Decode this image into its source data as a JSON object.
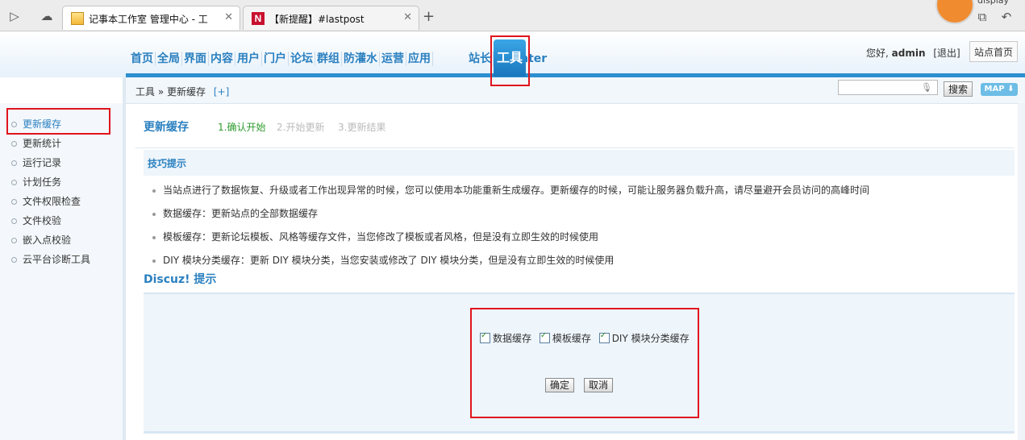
{
  "browser": {
    "tabs": [
      {
        "title": "记事本工作室 管理中心 - 工",
        "active": true,
        "icon": "sticky-note-icon"
      },
      {
        "title": "【新提醒】#lastpost",
        "active": false,
        "icon": "n-logo-icon"
      }
    ],
    "new_tab_label": "+",
    "corner_text": "display"
  },
  "nav": {
    "items": [
      "首页",
      "全局",
      "界面",
      "内容",
      "用户",
      "门户",
      "论坛",
      "群组",
      "防灌水",
      "运营",
      "应用"
    ],
    "active": "工具",
    "after": [
      "站长",
      "UCenter"
    ]
  },
  "user": {
    "greeting": "您好,",
    "name": "admin",
    "logout": "[退出]",
    "home_button": "站点首页"
  },
  "breadcrumb": {
    "section": "工具",
    "separator": "»",
    "page": "更新缓存",
    "add": "[+]"
  },
  "search": {
    "placeholder": "",
    "button": "搜索",
    "map": "MAP"
  },
  "sidebar": {
    "items": [
      {
        "label": "更新缓存",
        "active": true
      },
      {
        "label": "更新统计",
        "active": false
      },
      {
        "label": "运行记录",
        "active": false
      },
      {
        "label": "计划任务",
        "active": false
      },
      {
        "label": "文件权限检查",
        "active": false
      },
      {
        "label": "文件校验",
        "active": false
      },
      {
        "label": "嵌入点校验",
        "active": false
      },
      {
        "label": "云平台诊断工具",
        "active": false
      }
    ]
  },
  "main": {
    "title": "更新缓存",
    "steps": [
      "1.确认开始",
      "2.开始更新",
      "3.更新结果"
    ],
    "tips_label": "技巧提示",
    "tips": [
      "当站点进行了数据恢复、升级或者工作出现异常的时候，您可以使用本功能重新生成缓存。更新缓存的时候，可能让服务器负载升高，请尽量避开会员访问的高峰时间",
      "数据缓存：更新站点的全部数据缓存",
      "模板缓存：更新论坛模板、风格等缓存文件，当您修改了模板或者风格，但是没有立即生效的时候使用",
      "DIY 模块分类缓存：更新 DIY 模块分类，当您安装或修改了 DIY 模块分类，但是没有立即生效的时候使用"
    ],
    "notice_title": "Discuz! 提示",
    "checkboxes": [
      "数据缓存",
      "模板缓存",
      "DIY 模块分类缓存"
    ],
    "confirm": "确定",
    "cancel": "取消"
  },
  "colors": {
    "accent": "#2b80c0",
    "highlight": "#e0141e",
    "step_current": "#2e9b2e"
  }
}
